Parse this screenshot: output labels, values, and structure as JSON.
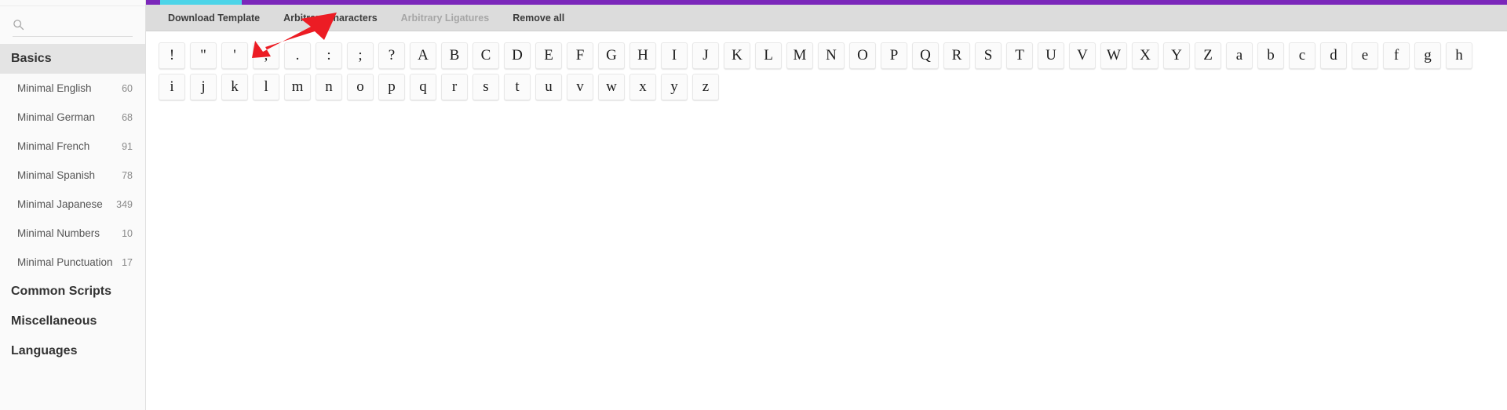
{
  "colors": {
    "accent_purple": "#7b27ba",
    "tab_underline_cyan": "#4cd4e8",
    "toolbar_bg": "#dcdcdc",
    "sidebar_bg": "#fafafa",
    "arrow_red": "#ec1c24"
  },
  "sidebar": {
    "search": {
      "placeholder": "",
      "value": "",
      "icon": "search-icon"
    },
    "sections": [
      {
        "label": "Basics",
        "active": true
      },
      {
        "label": "Common Scripts",
        "active": false
      },
      {
        "label": "Miscellaneous",
        "active": false
      },
      {
        "label": "Languages",
        "active": false
      }
    ],
    "items": [
      {
        "label": "Minimal English",
        "count": "60"
      },
      {
        "label": "Minimal German",
        "count": "68"
      },
      {
        "label": "Minimal French",
        "count": "91"
      },
      {
        "label": "Minimal Spanish",
        "count": "78"
      },
      {
        "label": "Minimal Japanese",
        "count": "349"
      },
      {
        "label": "Minimal Numbers",
        "count": "10"
      },
      {
        "label": "Minimal Punctuation",
        "count": "17"
      }
    ]
  },
  "toolbar": {
    "buttons": [
      {
        "label": "Download Template",
        "disabled": false
      },
      {
        "label": "Arbitrary characters",
        "disabled": false
      },
      {
        "label": "Arbitrary Ligatures",
        "disabled": true
      },
      {
        "label": "Remove all",
        "disabled": false
      }
    ]
  },
  "glyphs": [
    "!",
    "\"",
    "'",
    ",",
    ".",
    ":",
    ";",
    "?",
    "A",
    "B",
    "C",
    "D",
    "E",
    "F",
    "G",
    "H",
    "I",
    "J",
    "K",
    "L",
    "M",
    "N",
    "O",
    "P",
    "Q",
    "R",
    "S",
    "T",
    "U",
    "V",
    "W",
    "X",
    "Y",
    "Z",
    "a",
    "b",
    "c",
    "d",
    "e",
    "f",
    "g",
    "h",
    "i",
    "j",
    "k",
    "l",
    "m",
    "n",
    "o",
    "p",
    "q",
    "r",
    "s",
    "t",
    "u",
    "v",
    "w",
    "x",
    "y",
    "z"
  ],
  "annotation": {
    "name": "red-arrow-pointer",
    "points_to": "Download Template"
  }
}
